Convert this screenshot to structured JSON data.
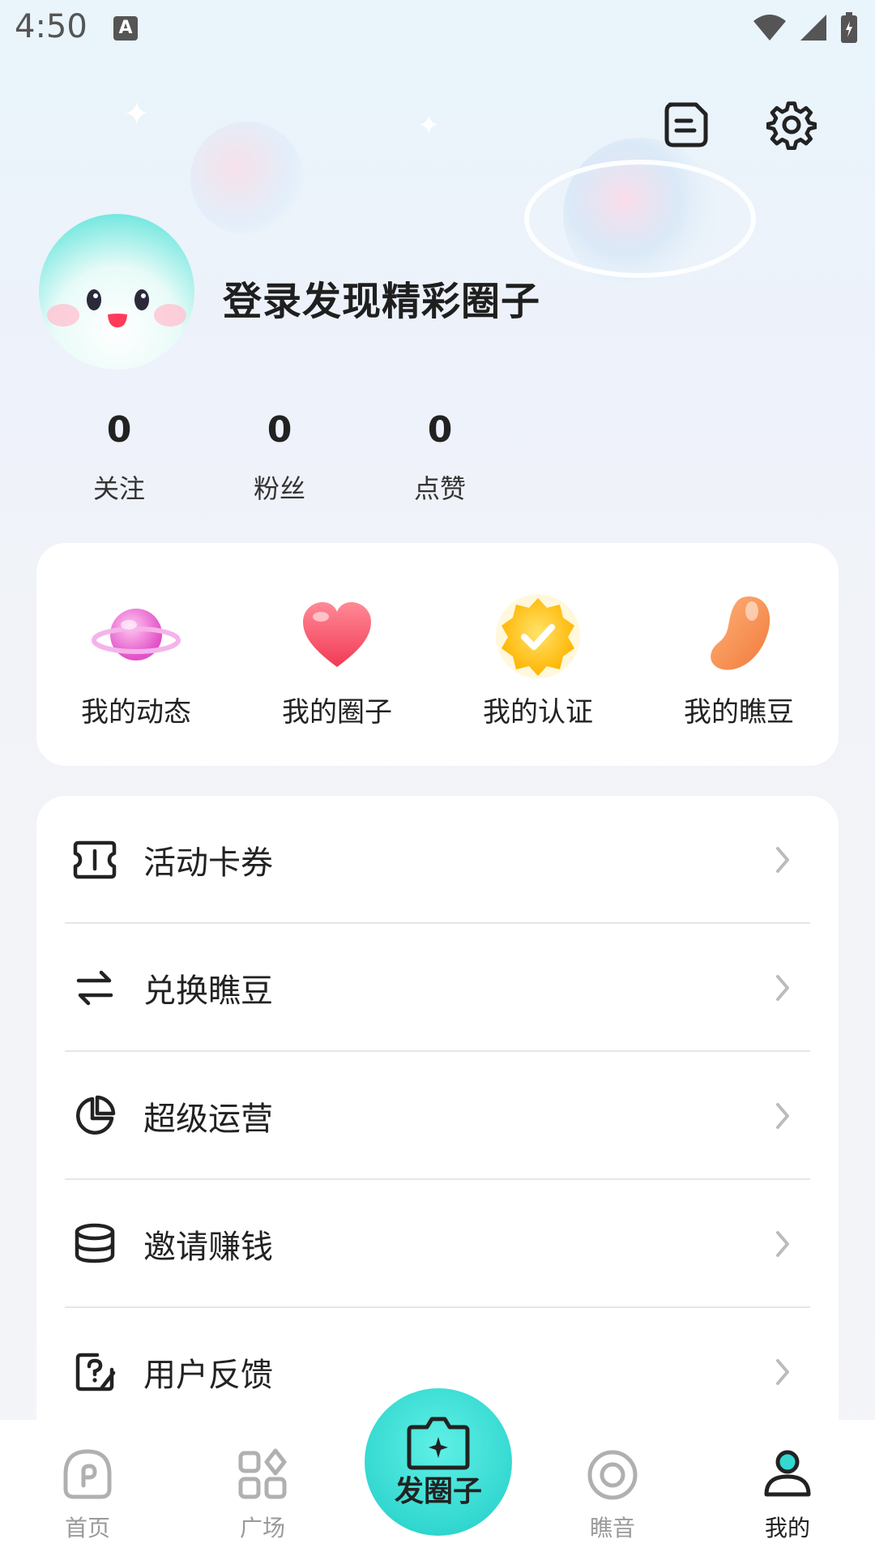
{
  "status_bar": {
    "time": "4:50",
    "notification_badge": "A"
  },
  "header": {
    "actions": [
      "note-icon",
      "gear-icon"
    ]
  },
  "profile": {
    "login_prompt": "登录发现精彩圈子"
  },
  "stats": [
    {
      "value": "0",
      "label": "关注"
    },
    {
      "value": "0",
      "label": "粉丝"
    },
    {
      "value": "0",
      "label": "点赞"
    }
  ],
  "quick_actions": [
    {
      "label": "我的动态",
      "icon": "planet-icon"
    },
    {
      "label": "我的圈子",
      "icon": "heart-icon"
    },
    {
      "label": "我的认证",
      "icon": "badge-check-icon"
    },
    {
      "label": "我的瞧豆",
      "icon": "bean-icon"
    }
  ],
  "menu": [
    {
      "label": "活动卡券",
      "icon": "ticket-icon"
    },
    {
      "label": "兑换瞧豆",
      "icon": "exchange-icon"
    },
    {
      "label": "超级运营",
      "icon": "pie-chart-icon"
    },
    {
      "label": "邀请赚钱",
      "icon": "coins-icon"
    },
    {
      "label": "用户反馈",
      "icon": "feedback-icon"
    }
  ],
  "bottom_nav": {
    "items": [
      {
        "label": "首页",
        "icon": "home-icon",
        "active": false
      },
      {
        "label": "广场",
        "icon": "grid-icon",
        "active": false
      },
      {
        "label": "瞧音",
        "icon": "disc-icon",
        "active": false
      },
      {
        "label": "我的",
        "icon": "user-icon",
        "active": true
      }
    ],
    "center_button": "发圈子"
  },
  "colors": {
    "accent": "#33d8d0",
    "background": "#f4f5f8",
    "card": "#ffffff"
  }
}
